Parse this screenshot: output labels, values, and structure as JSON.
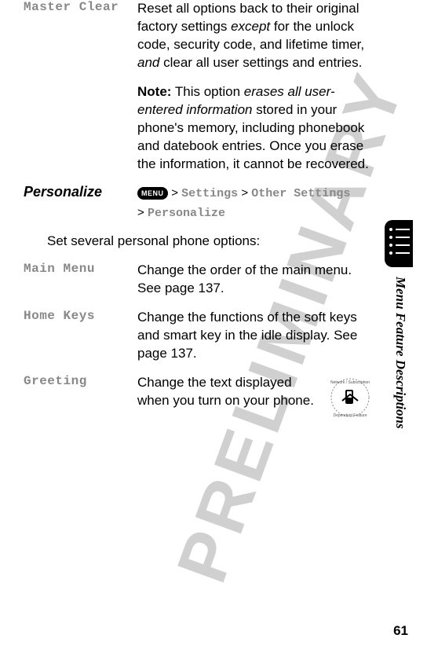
{
  "watermark": "PRELIMINARY",
  "master_clear": {
    "label": "Master Clear",
    "desc_parts": {
      "a": "Reset all options back to their original factory settings ",
      "b": "except",
      "c": " for the unlock code, security code, and lifetime timer, ",
      "d": "and",
      "e": " clear all user settings and entries."
    },
    "note": {
      "label": "Note:",
      "a": " This option ",
      "b": "erases all user-entered information",
      "c": " stored in your phone's memory, including phonebook and datebook entries. Once you erase the information, it cannot be recovered."
    }
  },
  "personalize": {
    "heading": "Personalize",
    "menu_badge": "MENU",
    "path": {
      "sep1": " > ",
      "p1": "Settings",
      "sep2": " > ",
      "p2": "Other Settings",
      "sep3": " > ",
      "p3": "Personalize"
    },
    "intro": "Set several personal phone options:"
  },
  "main_menu": {
    "label": "Main Menu",
    "desc": "Change the order of the main menu. See page 137."
  },
  "home_keys": {
    "label": "Home Keys",
    "desc": "Change the functions of the soft keys and smart key in the idle display. See page 137."
  },
  "greeting": {
    "label": "Greeting",
    "desc": "Change the text displayed when you turn on your phone."
  },
  "sidebar_label": "Menu Feature Descriptions",
  "page_number": "61"
}
